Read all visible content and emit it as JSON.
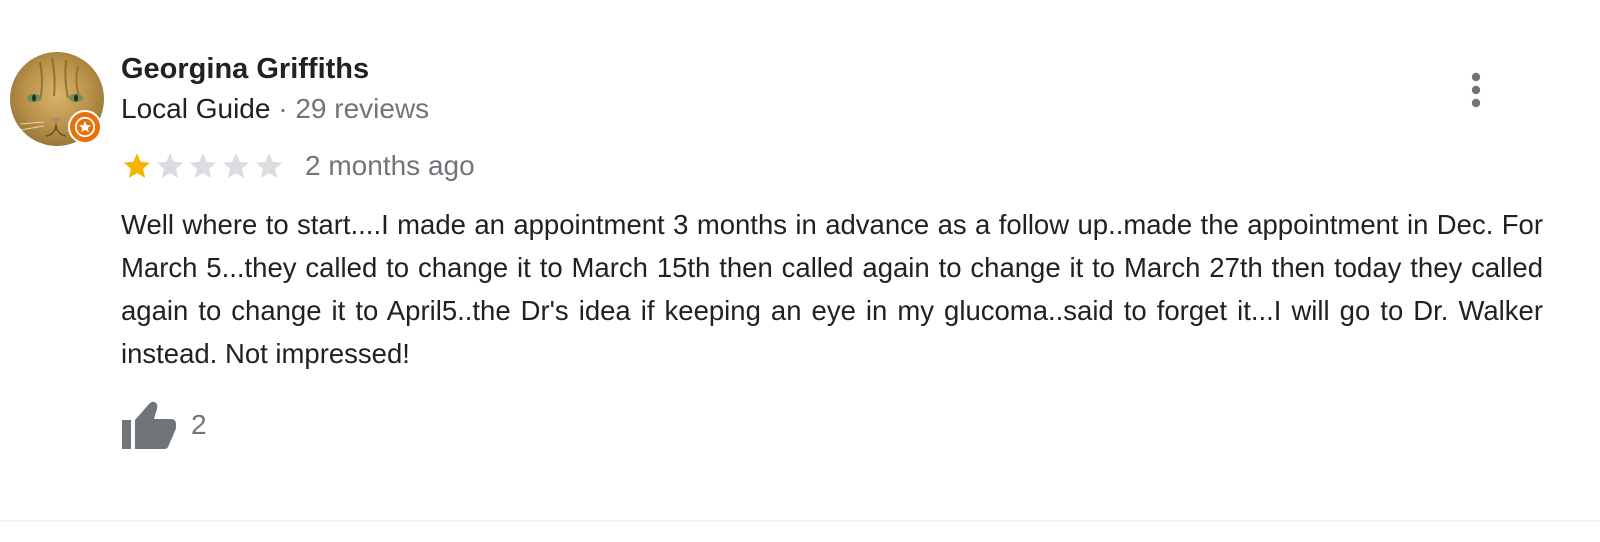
{
  "review": {
    "author": {
      "name": "Georgina Griffiths",
      "badge": "Local Guide",
      "separator": " · ",
      "review_count": "29 reviews",
      "avatar_icon": "cat-photo-avatar",
      "badge_icon": "local-guide-star-icon"
    },
    "rating": {
      "value": 1,
      "max": 5,
      "filled_color": "#f4b400",
      "empty_color": "#dadce0"
    },
    "timestamp": "2 months ago",
    "text": "Well where to start....I made an appointment 3 months in advance as a follow up..made the appointment in Dec. For March 5...they called to change it to March 15th then called again to change it to March 27th then today they called again to change it to April5..the Dr's idea if keeping an eye in my glucoma..said to forget it...I will go to Dr. Walker instead. Not impressed!",
    "likes": {
      "count": "2",
      "icon": "thumbs-up-icon"
    },
    "menu_icon": "more-vert-icon"
  },
  "colors": {
    "primary_text": "#202124",
    "secondary_text": "#70757a",
    "icon_gray": "#70757a",
    "guide_badge": "#e8710a"
  }
}
